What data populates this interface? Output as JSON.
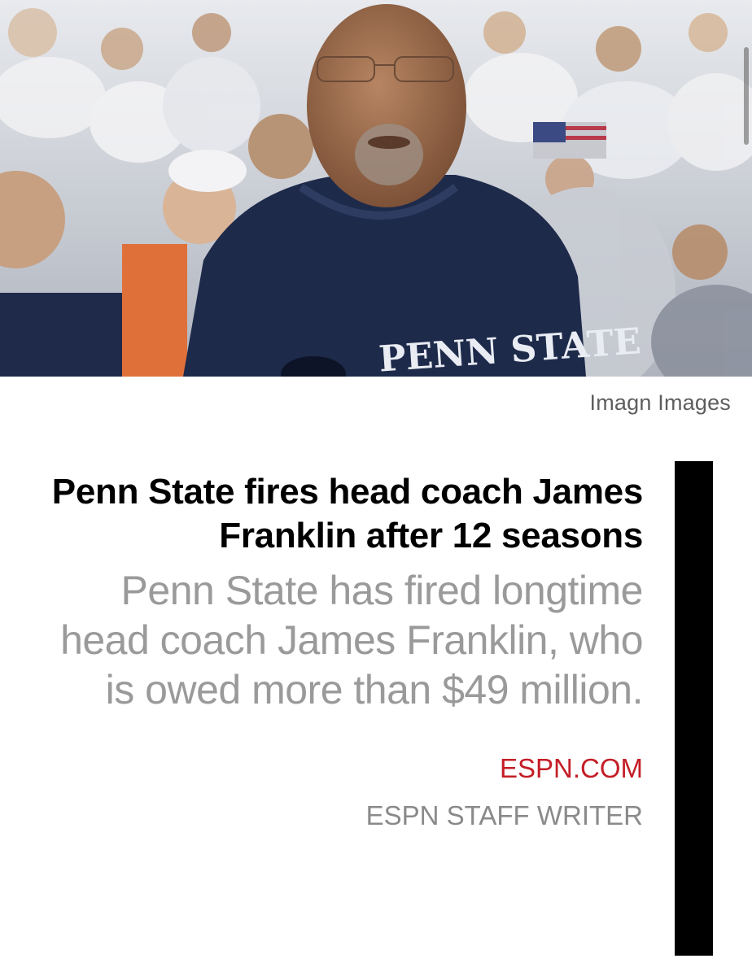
{
  "photo": {
    "alt": "Penn State coach on sideline with crowd behind",
    "credit": "Imagn Images",
    "hoodie_text": "PENN STATE"
  },
  "article": {
    "headline": "Penn State fires head coach James Franklin after 12 seasons",
    "dek": "Penn State has fired longtime head coach James Franklin, who is owed more than $49 million.",
    "source": "ESPN.COM",
    "byline": "ESPN STAFF WRITER"
  },
  "colors": {
    "source_red": "#c41e26",
    "accent_bar": "#000000",
    "hoodie_navy": "#1e2a4a"
  }
}
